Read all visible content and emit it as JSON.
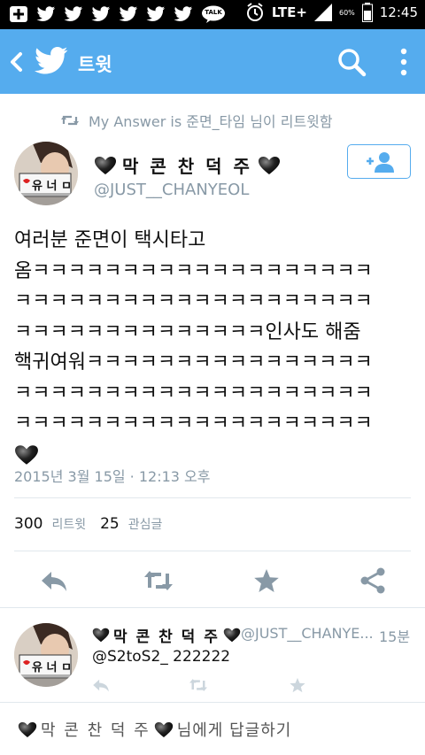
{
  "status_bar": {
    "lte": "LTE+",
    "battery": "60%",
    "time": "12:45",
    "icons": [
      "add-icon",
      "twitter-icon",
      "twitter-icon",
      "twitter-icon",
      "twitter-icon",
      "twitter-icon",
      "twitter-icon",
      "kakaotalk-icon"
    ],
    "talk_label": "TALK"
  },
  "appbar": {
    "title": "트윗",
    "color": "#55acee"
  },
  "retweet_context": {
    "text": "My Answer is 준면_타임 님이 리트윗함"
  },
  "tweet": {
    "name": "막 콘 찬 덕 주",
    "handle": "@JUST__CHANYEOL",
    "lines": [
      "여러분 준면이 택시타고",
      "옴ㅋㅋㅋㅋㅋㅋㅋㅋㅋㅋㅋㅋㅋㅋㅋㅋㅋㅋㅋ",
      "ㅋㅋㅋㅋㅋㅋㅋㅋㅋㅋㅋㅋㅋㅋㅋㅋㅋㅋㅋㅋ",
      "ㅋㅋㅋㅋㅋㅋㅋㅋㅋㅋㅋㅋㅋㅋ인사도 해줌",
      "핵귀여워ㅋㅋㅋㅋㅋㅋㅋㅋㅋㅋㅋㅋㅋㅋㅋㅋ",
      "ㅋㅋㅋㅋㅋㅋㅋㅋㅋㅋㅋㅋㅋㅋㅋㅋㅋㅋㅋㅋ",
      "ㅋㅋㅋㅋㅋㅋㅋㅋㅋㅋㅋㅋㅋㅋㅋㅋㅋㅋㅋㅋ"
    ],
    "timestamp": "2015년 3월 15일 · 12:13 오후",
    "retweets": "300",
    "retweets_label": "리트윗",
    "likes": "25",
    "likes_label": "관심글"
  },
  "reply": {
    "name": "막 콘 찬 덕 주",
    "handle": "@JUST__CHANYE...",
    "time": "15분",
    "text": "@S2toS2_ 222222"
  },
  "reply_box": {
    "placeholder_name": "막 콘 찬 덕 주",
    "placeholder_suffix": "님에게 답글하기"
  },
  "avatar": {
    "sign_text": "유 너 ㅁ 도"
  }
}
